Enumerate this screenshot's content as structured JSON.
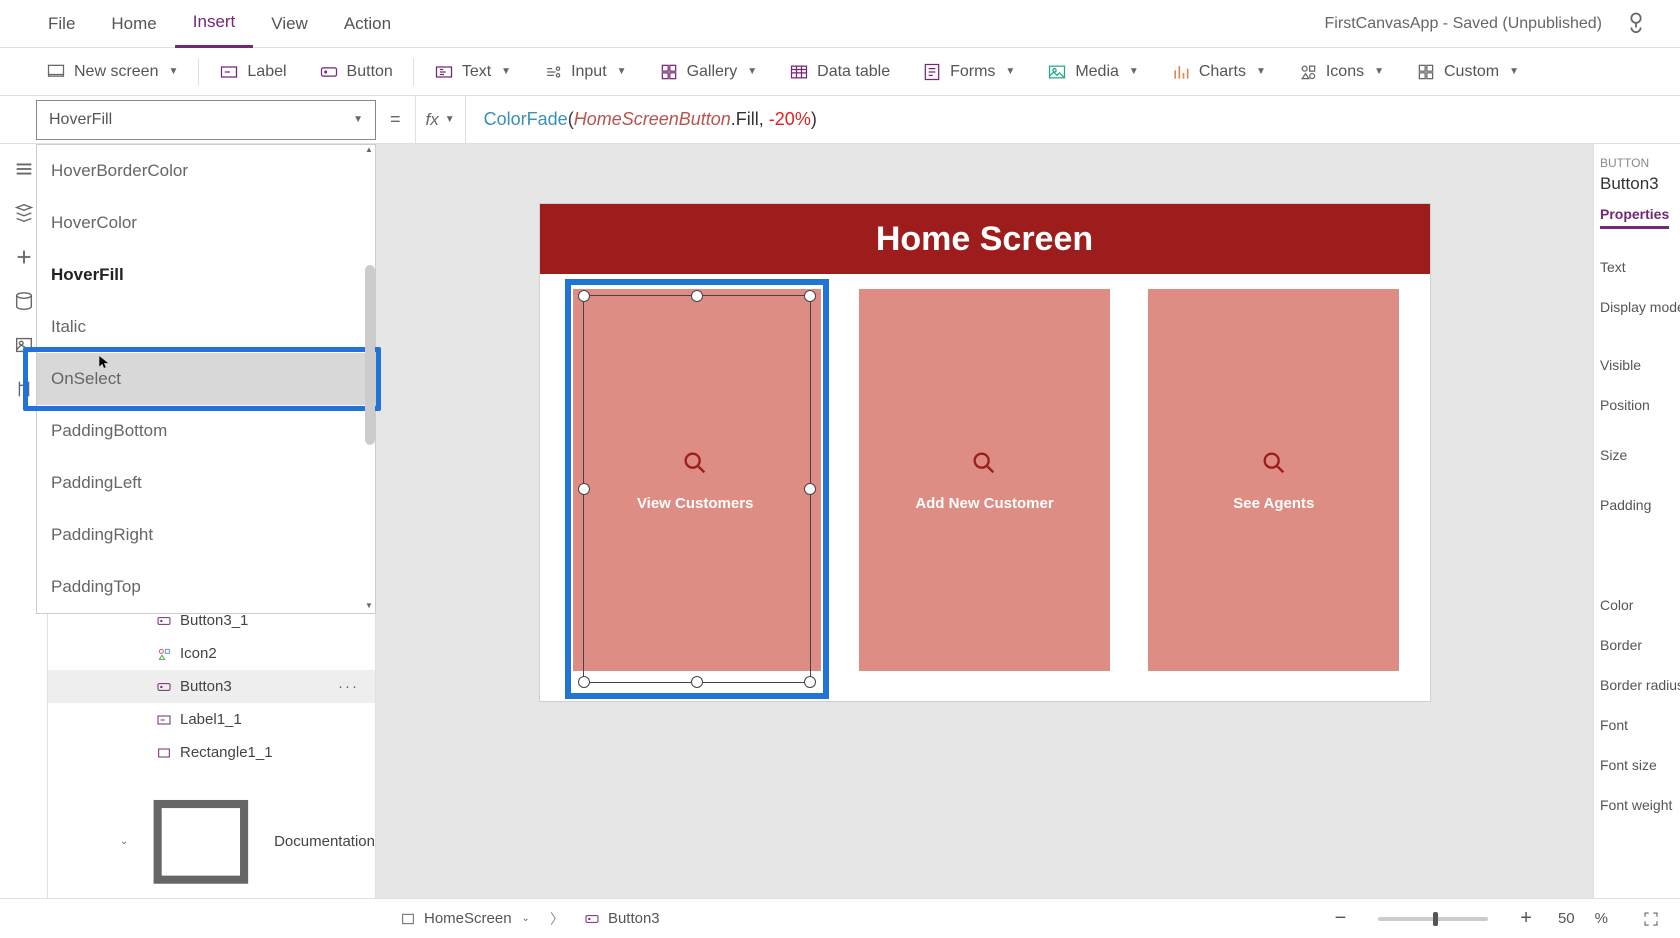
{
  "app": {
    "title_status": "FirstCanvasApp - Saved (Unpublished)"
  },
  "menu": {
    "file": "File",
    "home": "Home",
    "insert": "Insert",
    "view": "View",
    "action": "Action"
  },
  "ribbon": {
    "new_screen": "New screen",
    "label": "Label",
    "button": "Button",
    "text": "Text",
    "input": "Input",
    "gallery": "Gallery",
    "data_table": "Data table",
    "forms": "Forms",
    "media": "Media",
    "charts": "Charts",
    "icons": "Icons",
    "custom": "Custom"
  },
  "property_selector": {
    "value": "HoverFill"
  },
  "formula": {
    "fn": "ColorFade",
    "ref": "HomeScreenButton",
    "prop": ".Fill, ",
    "neg": "-20",
    "pct": "%"
  },
  "dropdown_items": {
    "i0": "HoverBorderColor",
    "i1": "HoverColor",
    "i2": "HoverFill",
    "i3": "Italic",
    "i4": "OnSelect",
    "i5": "PaddingBottom",
    "i6": "PaddingLeft",
    "i7": "PaddingRight",
    "i8": "PaddingTop"
  },
  "tree": {
    "t0": "Button3_1",
    "t1": "Icon2",
    "t2": "Button3",
    "t3": "Label1_1",
    "t4": "Rectangle1_1",
    "g0": "Documentation"
  },
  "canvas": {
    "header": "Home Screen",
    "card1": "View Customers",
    "card2": "Add New Customer",
    "card3": "See Agents"
  },
  "props": {
    "type": "BUTTON",
    "name": "Button3",
    "tab": "Properties",
    "r0": "Text",
    "r1": "Display mode",
    "r2": "Visible",
    "r3": "Position",
    "r4": "Size",
    "r5": "Padding",
    "r6": "Color",
    "r7": "Border",
    "r8": "Border radius",
    "r9": "Font",
    "r10": "Font size",
    "r11": "Font weight"
  },
  "bottom": {
    "screen": "HomeScreen",
    "sel": "Button3",
    "zoom": "50",
    "pct": "%"
  }
}
